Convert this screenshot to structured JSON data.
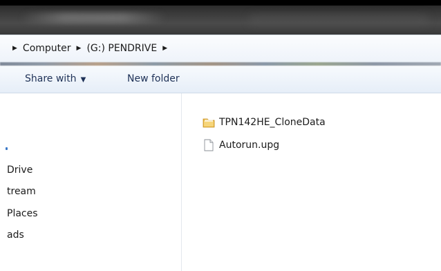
{
  "address": {
    "crumbs": [
      "Computer",
      "(G:) PENDRIVE"
    ]
  },
  "toolbar": {
    "share_label": "Share with",
    "new_folder_label": "New folder"
  },
  "nav": {
    "items": [
      "Drive",
      "tream",
      "Places",
      "ads"
    ]
  },
  "files": [
    {
      "name": "TPN142HE_CloneData",
      "icon": "folder-icon"
    },
    {
      "name": "Autorun.upg",
      "icon": "document-icon"
    }
  ],
  "colors": {
    "folder": "#e8b53a",
    "toolbar_text": "#1e3157",
    "nav_accent": "#3a78c7"
  }
}
